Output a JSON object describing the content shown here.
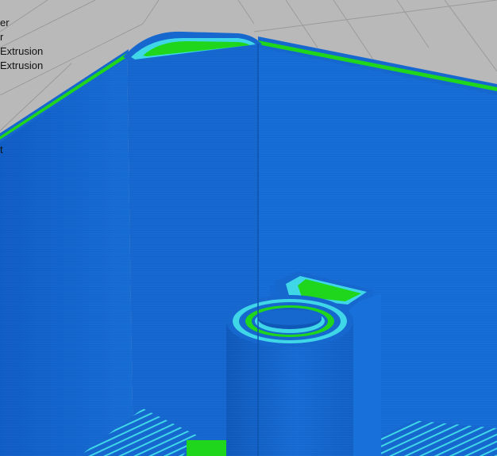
{
  "legend": {
    "lines": [
      "er",
      "r",
      "Extrusion",
      "Extrusion"
    ],
    "truncated_fragment": "t"
  },
  "colors": {
    "background": "#b9b9b9",
    "grid": "#9a9a9a",
    "perimeter_blue": "#1668cf",
    "perimeter_blue_dark": "#0f58b8",
    "outer_edge_cyan": "#3fd6e8",
    "infill_green": "#20d61c"
  },
  "icons": {
    "model": "3d-print-preview-model-icon"
  }
}
